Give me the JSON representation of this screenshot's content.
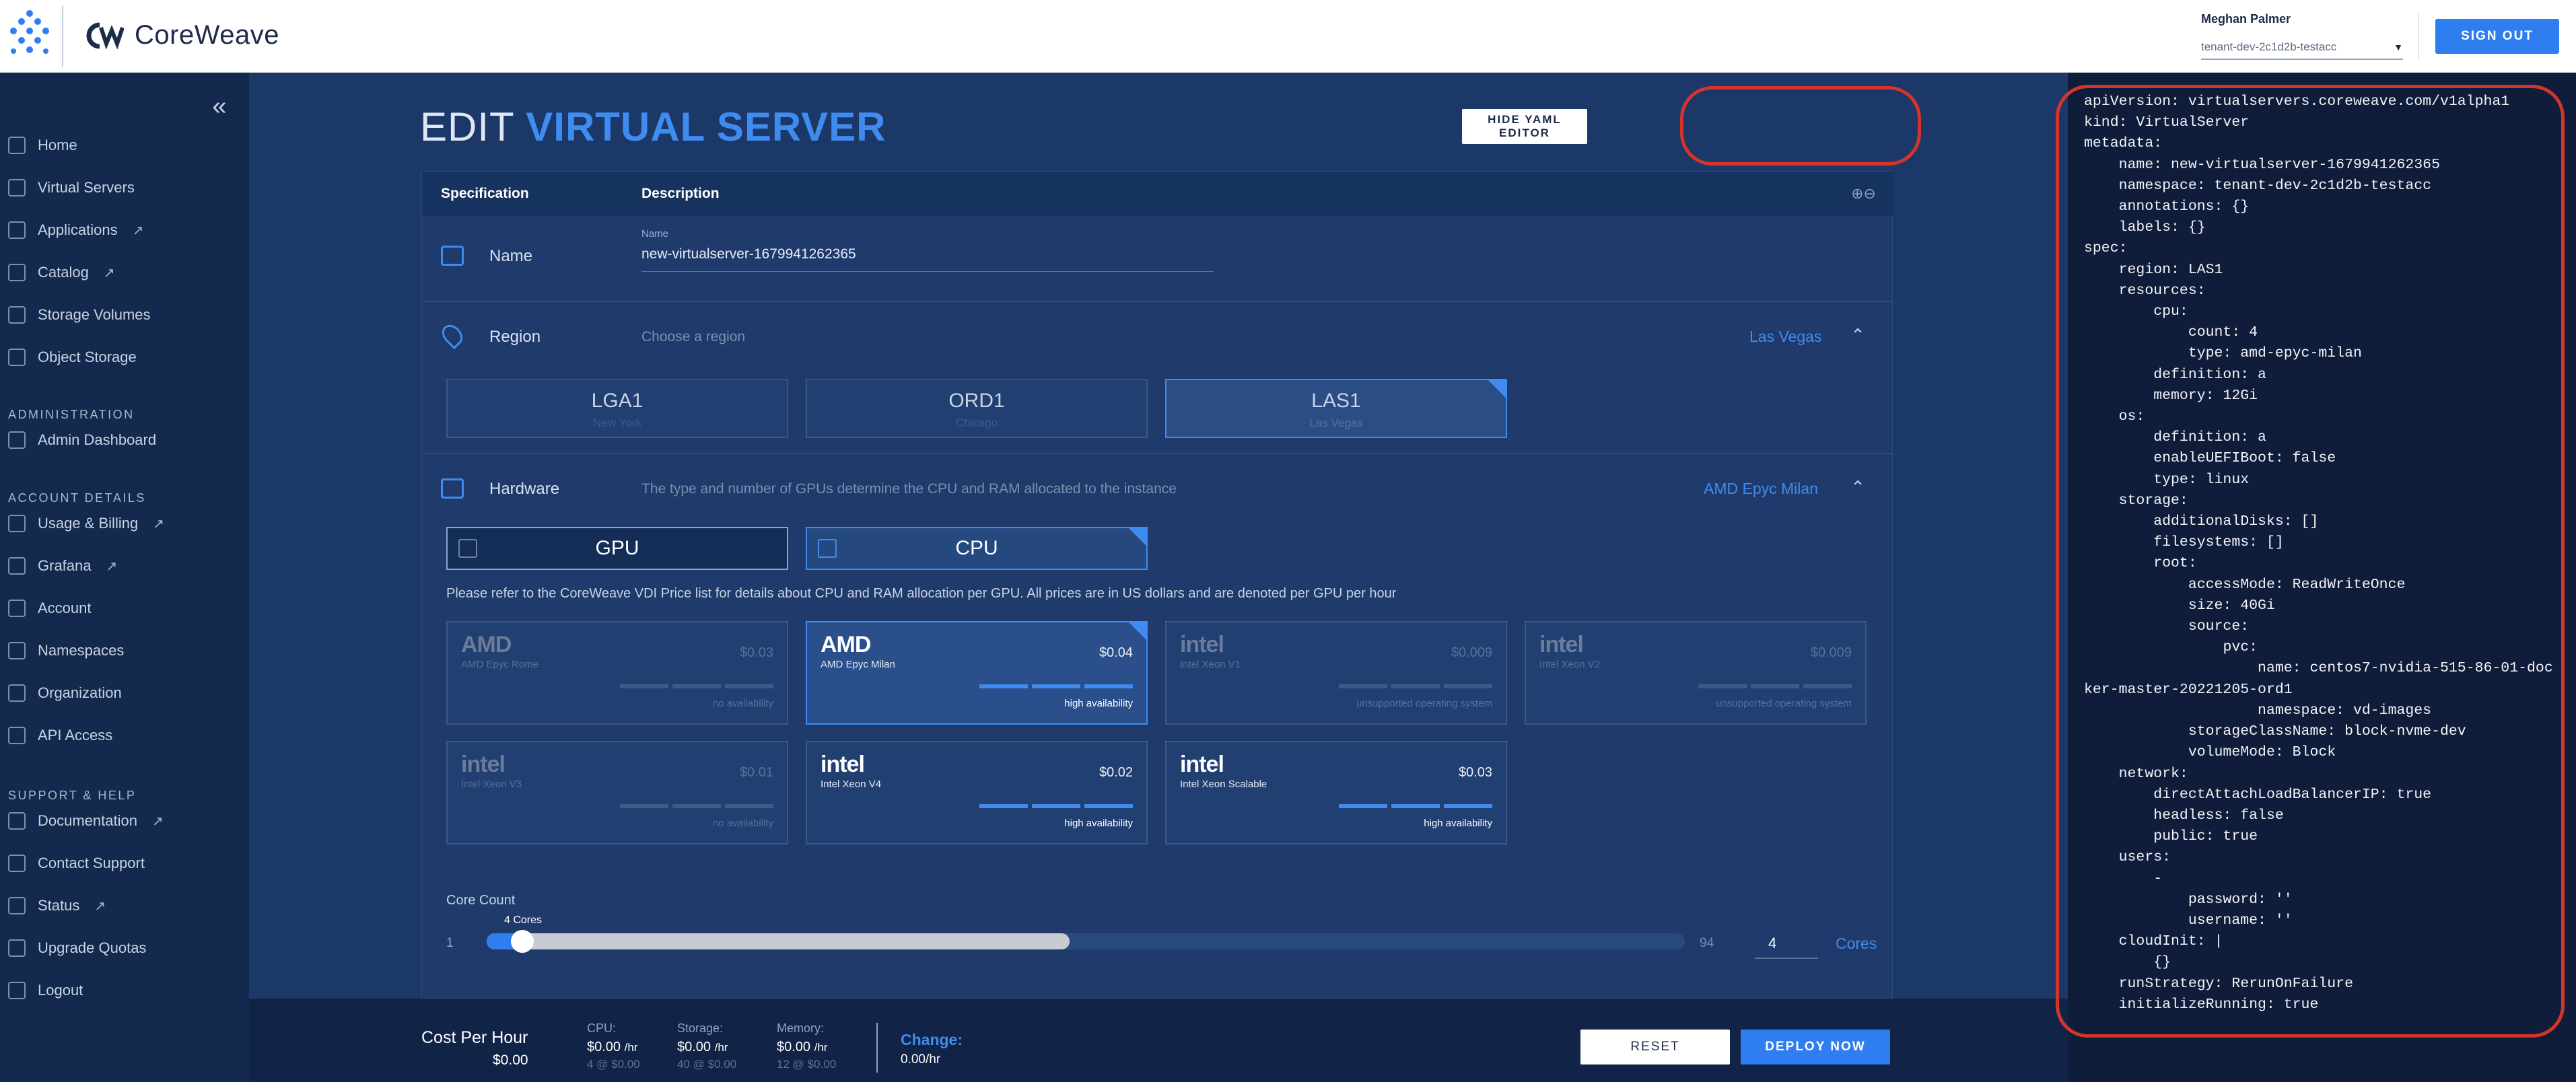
{
  "header": {
    "brand": "CoreWeave",
    "user_name": "Meghan Palmer",
    "tenant": "tenant-dev-2c1d2b-testacc",
    "sign_out": "SIGN OUT"
  },
  "sidebar": {
    "collapse_icon": "chevron-double-left-icon",
    "items": [
      {
        "label": "Home",
        "icon": "home-icon"
      },
      {
        "label": "Virtual Servers",
        "icon": "monitor-icon"
      },
      {
        "label": "Applications",
        "icon": "grid-icon",
        "external": true
      },
      {
        "label": "Catalog",
        "icon": "folder-icon",
        "external": true
      },
      {
        "label": "Storage Volumes",
        "icon": "database-icon"
      },
      {
        "label": "Object Storage",
        "icon": "bucket-icon"
      }
    ],
    "sections": [
      {
        "title": "ADMINISTRATION",
        "items": [
          {
            "label": "Admin Dashboard",
            "icon": "dashboard-icon"
          }
        ]
      },
      {
        "title": "ACCOUNT DETAILS",
        "items": [
          {
            "label": "Usage & Billing",
            "icon": "document-icon",
            "external": true
          },
          {
            "label": "Grafana",
            "icon": "chart-icon",
            "external": true
          },
          {
            "label": "Account",
            "icon": "user-icon"
          },
          {
            "label": "Namespaces",
            "icon": "people-icon"
          },
          {
            "label": "Organization",
            "icon": "org-icon"
          },
          {
            "label": "API Access",
            "icon": "cloud-icon"
          }
        ]
      },
      {
        "title": "SUPPORT & HELP",
        "items": [
          {
            "label": "Documentation",
            "icon": "book-icon",
            "external": true
          },
          {
            "label": "Contact Support",
            "icon": "chat-icon"
          },
          {
            "label": "Status",
            "icon": "info-icon",
            "external": true
          },
          {
            "label": "Upgrade Quotas",
            "icon": "plus-icon"
          },
          {
            "label": "Logout",
            "icon": "logout-icon"
          }
        ]
      }
    ]
  },
  "page": {
    "title_prefix": "EDIT",
    "title_main": "VIRTUAL SERVER",
    "hide_yaml": "HIDE YAML EDITOR"
  },
  "table": {
    "col_spec": "Specification",
    "col_desc": "Description",
    "expand_icons": "⊕⊖"
  },
  "name_row": {
    "label": "Name",
    "field_caption": "Name",
    "value": "new-virtualserver-1679941262365"
  },
  "region_row": {
    "label": "Region",
    "description": "Choose a region",
    "selected": "Las Vegas",
    "options": [
      {
        "code": "LGA1",
        "city": "New York"
      },
      {
        "code": "ORD1",
        "city": "Chicago"
      },
      {
        "code": "LAS1",
        "city": "Las Vegas"
      }
    ]
  },
  "hardware_row": {
    "label": "Hardware",
    "description": "The type and number of GPUs determine the CPU and RAM allocated to the instance",
    "selected": "AMD Epyc Milan",
    "gpu_label": "GPU",
    "cpu_label": "CPU",
    "note": "Please refer to the CoreWeave VDI Price list for details about CPU and RAM allocation per GPU. All prices are in US dollars and are denoted per GPU per hour",
    "options": [
      {
        "logo": "AMD",
        "name": "AMD Epyc Rome",
        "price": "$0.03",
        "availability": "no availability"
      },
      {
        "logo": "AMD",
        "name": "AMD Epyc Milan",
        "price": "$0.04",
        "availability": "high availability"
      },
      {
        "logo": "intel",
        "name": "Intel Xeon V1",
        "price": "$0.009",
        "availability": "unsupported operating system"
      },
      {
        "logo": "intel",
        "name": "Intel Xeon V2",
        "price": "$0.009",
        "availability": "unsupported operating system"
      },
      {
        "logo": "intel",
        "name": "Intel Xeon V3",
        "price": "$0.01",
        "availability": "no availability"
      },
      {
        "logo": "intel",
        "name": "Intel Xeon V4",
        "price": "$0.02",
        "availability": "high availability"
      },
      {
        "logo": "intel",
        "name": "Intel Xeon Scalable",
        "price": "$0.03",
        "availability": "high availability"
      }
    ],
    "core_count_label": "Core Count",
    "tooltip": "4 Cores",
    "min": "1",
    "max": "94",
    "cores": "4",
    "cores_unit": "Cores"
  },
  "footer": {
    "cost_title": "Cost Per Hour",
    "cost_amount": "$0.00",
    "cpu": {
      "label": "CPU:",
      "value": "$0.00",
      "unit": "/hr",
      "sub": "4 @ $0.00"
    },
    "storage": {
      "label": "Storage:",
      "value": "$0.00",
      "unit": "/hr",
      "sub": "40 @ $0.00"
    },
    "memory": {
      "label": "Memory:",
      "value": "$0.00",
      "unit": "/hr",
      "sub": "12 @ $0.00"
    },
    "change_label": "Change:",
    "change_value": "0.00/hr",
    "reset": "RESET",
    "deploy": "DEPLOY NOW"
  },
  "yaml": "apiVersion: virtualservers.coreweave.com/v1alpha1\nkind: VirtualServer\nmetadata:\n    name: new-virtualserver-1679941262365\n    namespace: tenant-dev-2c1d2b-testacc\n    annotations: {}\n    labels: {}\nspec:\n    region: LAS1\n    resources:\n        cpu:\n            count: 4\n            type: amd-epyc-milan\n        definition: a\n        memory: 12Gi\n    os:\n        definition: a\n        enableUEFIBoot: false\n        type: linux\n    storage:\n        additionalDisks: []\n        filesystems: []\n        root:\n            accessMode: ReadWriteOnce\n            size: 40Gi\n            source:\n                pvc:\n                    name: centos7-nvidia-515-86-01-docker-master-20221205-ord1\n                    namespace: vd-images\n            storageClassName: block-nvme-dev\n            volumeMode: Block\n    network:\n        directAttachLoadBalancerIP: true\n        headless: false\n        public: true\n    users:\n        -\n            password: ''\n            username: ''\n    cloudInit: |\n        {}\n    runStrategy: RerunOnFailure\n    initializeRunning: true"
}
